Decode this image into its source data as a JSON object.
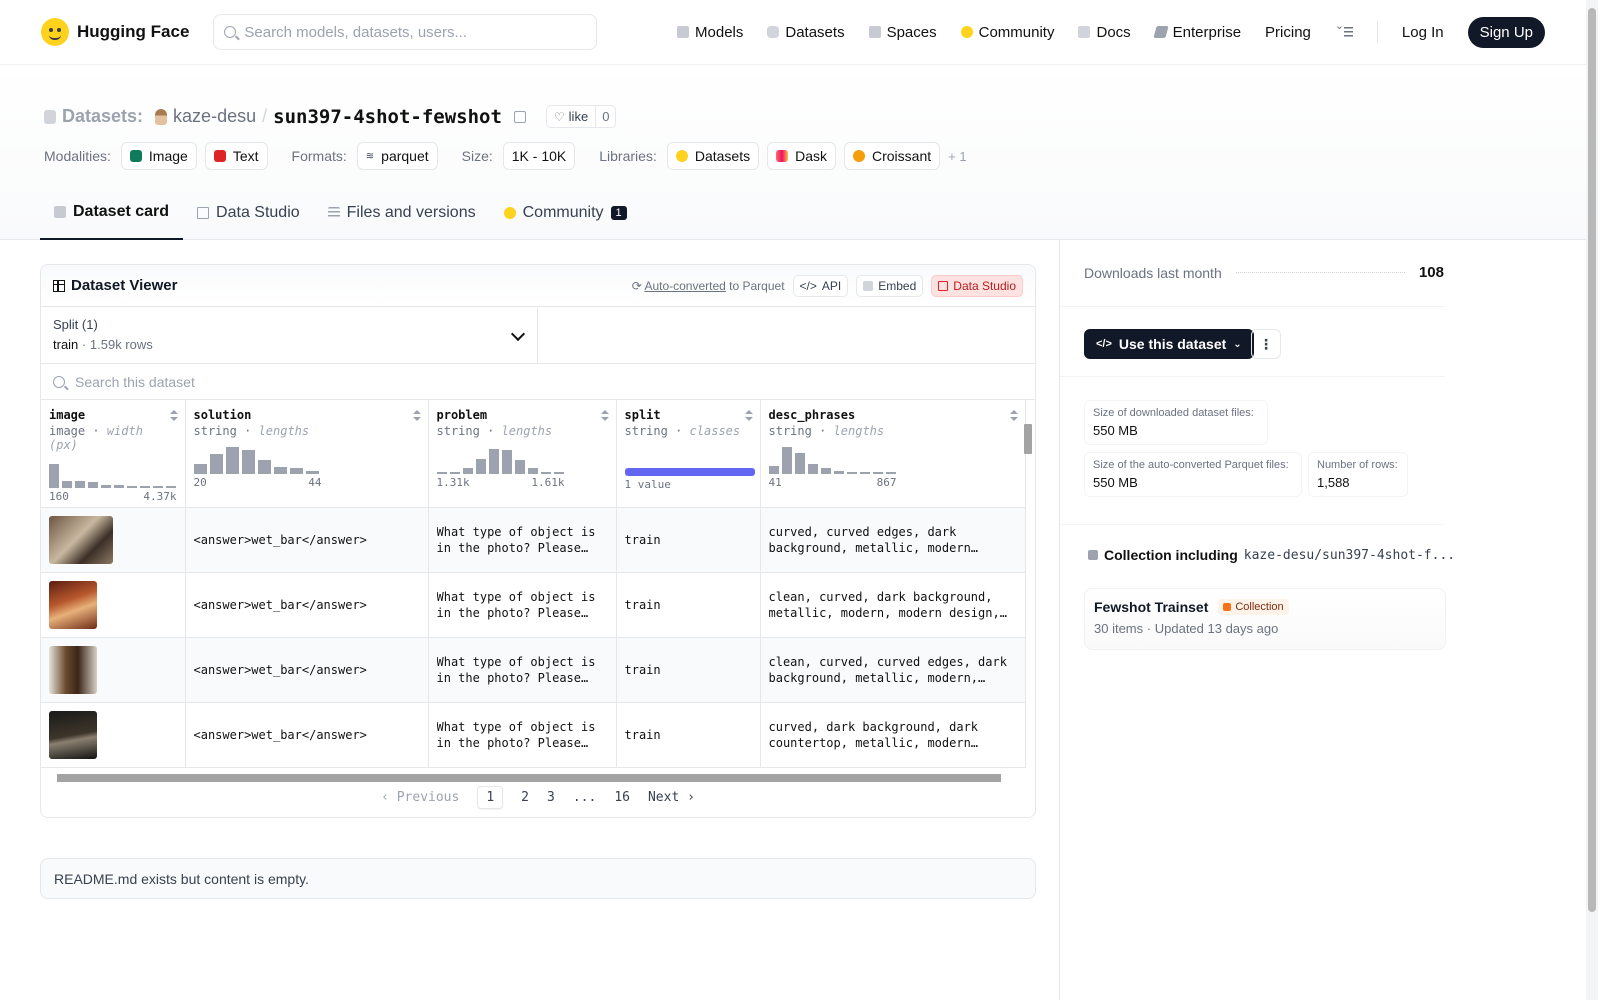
{
  "nav": {
    "brand": "Hugging Face",
    "search_placeholder": "Search models, datasets, users...",
    "links": [
      {
        "label": "Models",
        "icon": "cube-icon"
      },
      {
        "label": "Datasets",
        "icon": "database-icon"
      },
      {
        "label": "Spaces",
        "icon": "grid-icon"
      },
      {
        "label": "Community",
        "icon": "hug-icon"
      },
      {
        "label": "Docs",
        "icon": "book-icon"
      },
      {
        "label": "Enterprise",
        "icon": "enterprise-icon"
      },
      {
        "label": "Pricing"
      }
    ],
    "login": "Log In",
    "signup": "Sign Up"
  },
  "repo": {
    "type_label": "Datasets:",
    "owner": "kaze-desu",
    "slash": "/",
    "name": "sun397-4shot-fewshot",
    "like_label": "like",
    "like_count": "0"
  },
  "meta": {
    "modalities_label": "Modalities:",
    "modalities": [
      "Image",
      "Text"
    ],
    "formats_label": "Formats:",
    "format": "parquet",
    "size_label": "Size:",
    "size": "1K - 10K",
    "libraries_label": "Libraries:",
    "libraries": [
      "Datasets",
      "Dask",
      "Croissant"
    ],
    "more": "+ 1"
  },
  "tabs": [
    {
      "label": "Dataset card",
      "active": true
    },
    {
      "label": "Data Studio"
    },
    {
      "label": "Files and versions"
    },
    {
      "label": "Community",
      "badge": "1"
    }
  ],
  "viewer": {
    "title": "Dataset Viewer",
    "autoconv_link": "Auto-converted",
    "autoconv_rest": " to Parquet",
    "api": "API",
    "embed": "Embed",
    "data_studio": "Data Studio",
    "split_label": "Split (1)",
    "split_name": "train",
    "split_dot": "·",
    "split_rows": "1.59k rows",
    "search_placeholder": "Search this dataset",
    "columns": [
      {
        "name": "image",
        "type": "image",
        "stat": "width (px)",
        "min": "160",
        "max": "4.37k",
        "hist": [
          0.85,
          0.25,
          0.25,
          0.2,
          0.12,
          0.1,
          0.08,
          0.06,
          0.05,
          0.04
        ]
      },
      {
        "name": "solution",
        "type": "string",
        "stat": "lengths",
        "min": "20",
        "max": "44",
        "hist": [
          0.35,
          0.7,
          0.95,
          0.85,
          0.5,
          0.25,
          0.2,
          0.1
        ]
      },
      {
        "name": "problem",
        "type": "string",
        "stat": "lengths",
        "min": "1.31k",
        "max": "1.61k",
        "hist": [
          0.05,
          0.08,
          0.2,
          0.55,
          0.9,
          0.85,
          0.5,
          0.2,
          0.05,
          0.05
        ]
      },
      {
        "name": "split",
        "type": "string",
        "stat": "classes",
        "class_label": "1 value"
      },
      {
        "name": "desc_phrases",
        "type": "string",
        "stat": "lengths",
        "min": "41",
        "max": "867",
        "hist": [
          0.3,
          0.95,
          0.75,
          0.35,
          0.2,
          0.12,
          0.08,
          0.06,
          0.05,
          0.04
        ]
      }
    ],
    "rows": [
      {
        "solution": "<answer>wet_bar</answer>",
        "problem": "What type of object is in the photo? Please choose one of the following options",
        "split": "train",
        "desc": "curved, curved edges, dark background, metallic, modern design, reflective surfaces"
      },
      {
        "solution": "<answer>wet_bar</answer>",
        "problem": "What type of object is in the photo? Please choose one of the following options",
        "split": "train",
        "desc": "clean, curved, dark background, metallic, modern, modern design, reflective"
      },
      {
        "solution": "<answer>wet_bar</answer>",
        "problem": "What type of object is in the photo? Please choose one of the following options",
        "split": "train",
        "desc": "clean, curved, curved edges, dark background, metallic, modern, reflective"
      },
      {
        "solution": "<answer>wet_bar</answer>",
        "problem": "What type of object is in the photo? Please choose one of the following options",
        "split": "train",
        "desc": "curved, dark background, dark countertop, metallic, modern design, reflective"
      }
    ],
    "pager": {
      "prev": "Previous",
      "pages": [
        "1",
        "2",
        "3",
        "...",
        "16"
      ],
      "next": "Next"
    }
  },
  "readme": "README.md exists but content is empty.",
  "sidebar": {
    "downloads_label": "Downloads last month",
    "downloads": "108",
    "use_button": "Use this dataset",
    "stats": [
      {
        "label": "Size of downloaded dataset files:",
        "value": "550 MB"
      },
      {
        "label": "Size of the auto-converted Parquet files:",
        "value": "550 MB"
      },
      {
        "label": "Number of rows:",
        "value": "1,588"
      }
    ],
    "collection_heading": "Collection including",
    "collection_repo": "kaze-desu/sun397-4shot-f...",
    "collection_name": "Fewshot Trainset",
    "collection_badge": "Collection",
    "collection_items": "30 items",
    "collection_dot": "·",
    "collection_updated": "Updated 13 days ago"
  },
  "colors": {
    "accent": "#111827",
    "class_bar": "#6366f1",
    "hist": "#9ca3af",
    "hf_yellow": "#ffd21e"
  }
}
